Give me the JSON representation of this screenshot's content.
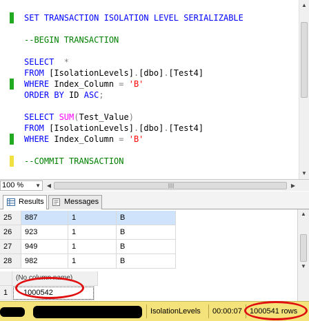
{
  "editor": {
    "lines": [
      {
        "tokens": [
          {
            "text": "SET TRANSACTION ISOLATION LEVEL SERIALIZABLE",
            "color": "#0000ff"
          }
        ],
        "marker": "#22aa22"
      },
      {
        "tokens": [
          {
            "text": "",
            "color": "#000"
          }
        ],
        "marker": null
      },
      {
        "tokens": [
          {
            "text": "--BEGIN TRANSACTION",
            "color": "#008000"
          }
        ],
        "marker": null
      },
      {
        "tokens": [
          {
            "text": "",
            "color": "#000"
          }
        ],
        "marker": null
      },
      {
        "tokens": [
          {
            "text": "SELECT ",
            "color": "#0000ff"
          },
          {
            "text": " *",
            "color": "#808080"
          }
        ],
        "marker": null
      },
      {
        "tokens": [
          {
            "text": "FROM ",
            "color": "#0000ff"
          },
          {
            "text": "[IsolationLevels]",
            "color": "#000000"
          },
          {
            "text": ".",
            "color": "#808080"
          },
          {
            "text": "[dbo]",
            "color": "#000000"
          },
          {
            "text": ".",
            "color": "#808080"
          },
          {
            "text": "[Test4]",
            "color": "#000000"
          }
        ],
        "marker": null
      },
      {
        "tokens": [
          {
            "text": "WHERE ",
            "color": "#0000ff"
          },
          {
            "text": "Index_Column ",
            "color": "#000000"
          },
          {
            "text": "= ",
            "color": "#808080"
          },
          {
            "text": "'B'",
            "color": "#ff0000"
          }
        ],
        "marker": "#22aa22"
      },
      {
        "tokens": [
          {
            "text": "ORDER BY ",
            "color": "#0000ff"
          },
          {
            "text": "ID ",
            "color": "#000000"
          },
          {
            "text": "ASC",
            "color": "#0000ff"
          },
          {
            "text": ";",
            "color": "#808080"
          }
        ],
        "marker": null
      },
      {
        "tokens": [
          {
            "text": "",
            "color": "#000"
          }
        ],
        "marker": null
      },
      {
        "tokens": [
          {
            "text": "SELECT ",
            "color": "#0000ff"
          },
          {
            "text": "SUM",
            "color": "#ff00ff"
          },
          {
            "text": "(",
            "color": "#808080"
          },
          {
            "text": "Test_Value",
            "color": "#000000"
          },
          {
            "text": ")",
            "color": "#808080"
          }
        ],
        "marker": null
      },
      {
        "tokens": [
          {
            "text": "FROM ",
            "color": "#0000ff"
          },
          {
            "text": "[IsolationLevels]",
            "color": "#000000"
          },
          {
            "text": ".",
            "color": "#808080"
          },
          {
            "text": "[dbo]",
            "color": "#000000"
          },
          {
            "text": ".",
            "color": "#808080"
          },
          {
            "text": "[Test4]",
            "color": "#000000"
          }
        ],
        "marker": null
      },
      {
        "tokens": [
          {
            "text": "WHERE ",
            "color": "#0000ff"
          },
          {
            "text": "Index_Column ",
            "color": "#000000"
          },
          {
            "text": "= ",
            "color": "#808080"
          },
          {
            "text": "'B'",
            "color": "#ff0000"
          }
        ],
        "marker": "#22aa22"
      },
      {
        "tokens": [
          {
            "text": "",
            "color": "#000"
          }
        ],
        "marker": null
      },
      {
        "tokens": [
          {
            "text": "--COMMIT TRANSACTION",
            "color": "#008000"
          }
        ],
        "marker": "#f0e040"
      }
    ]
  },
  "zoom": {
    "value": "100 %"
  },
  "tabs": [
    {
      "label": "Results",
      "icon": "grid-icon",
      "active": true
    },
    {
      "label": "Messages",
      "icon": "messages-icon",
      "active": false
    }
  ],
  "results": {
    "grid1": {
      "rows": [
        {
          "num": "25",
          "cells": [
            "887",
            "1",
            "B"
          ],
          "selected": true
        },
        {
          "num": "26",
          "cells": [
            "923",
            "1",
            "B"
          ],
          "selected": false
        },
        {
          "num": "27",
          "cells": [
            "949",
            "1",
            "B"
          ],
          "selected": false
        },
        {
          "num": "28",
          "cells": [
            "982",
            "1",
            "B"
          ],
          "selected": false
        }
      ]
    },
    "grid2": {
      "header": "(No column name)",
      "rows": [
        {
          "num": "1",
          "value": "1000542"
        }
      ]
    }
  },
  "status": {
    "database": "IsolationLevels",
    "elapsed": "00:00:07",
    "rows": "1000541 rows"
  },
  "colors": {
    "annotation": "#e01010",
    "status_bar": "#f4e27a",
    "selection": "#cfe3fb"
  }
}
